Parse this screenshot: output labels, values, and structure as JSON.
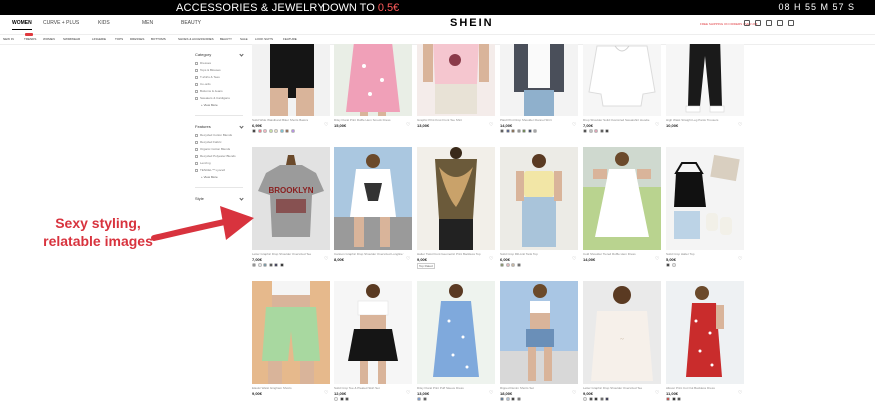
{
  "promo": {
    "accessories": "ACCESSORIES & JEWELRY",
    "down_to": "DOWN TO ",
    "price": "0.5€",
    "timer": "08 H 55 M 57 S"
  },
  "header": {
    "categories": [
      "WOMEN",
      "CURVE + PLUS",
      "KIDS",
      "MEN",
      "BEAUTY"
    ],
    "logo": "SHEIN",
    "topright": "FREE SHIPPING ON ORDERS OVER 29€"
  },
  "subnav": [
    "NEW IN",
    "TRENDS",
    "WOMEN",
    "SWIMWEAR",
    "LINGERIE",
    "TOPS",
    "DRESSES",
    "BOTTOMS",
    "SHOES & ACCESSORIES",
    "BEAUTY",
    "SALE",
    "LOOK SUITS",
    "FEATURE"
  ],
  "sidebar": {
    "category_title": "Category",
    "category_items": [
      "Dresses",
      "Tops & Blouses",
      "T-shirts & Tees",
      "Co-ords",
      "Bottoms & Jeans",
      "Sweaters & Cardigans"
    ],
    "view_more": "+ View More",
    "features_title": "Features",
    "features_items": [
      "Recycled Cotton Blends",
      "Recycled Fabric",
      "Organic Cotton Blends",
      "Recycled Polyester Blends",
      "Lenzing",
      "TENCEL™ Lyocell"
    ],
    "view_more_2": "+ View More",
    "style_title": "Style"
  },
  "products": [
    {
      "name": "Solid Wide Waistband Biker Shorts Basics",
      "price": "6,99€",
      "swatches": [
        "#222222",
        "#ff6b81",
        "#ffb3c1",
        "#c7e99a",
        "#f2e6c9",
        "#6cc3d5",
        "#8a5a3b",
        "#b388eb"
      ]
    },
    {
      "name": "Ditsy Floral Print Ruffle Hem Smock Dress",
      "price": "15,00€",
      "swatches": []
    },
    {
      "name": "Graphic Print Knot Front Tee Shirt",
      "price": "13,00€",
      "swatches": []
    },
    {
      "name": "Plaid Print Drop Shoulder Flannel Shirt",
      "price": "14,00€",
      "swatches": [
        "#444444",
        "#3b4a7a",
        "#7a5c3b",
        "#888888",
        "#5a7a3b",
        "#223355",
        "#a0a0a0"
      ]
    },
    {
      "name": "Drop Shoulder Solid Oversized Sweatshirt Hoodie",
      "price": "7,00€",
      "swatches": [
        "#333333",
        "#c0c0c0",
        "#e8a0b4",
        "#444444",
        "#222222"
      ]
    },
    {
      "name": "High Waist Straight Leg Pants Trousers",
      "price": "10,00€",
      "swatches": []
    },
    {
      "name": "Letter Graphic Drop Shoulder Oversized Tee",
      "price": "7,00€",
      "tag": "",
      "swatches": [
        "#888888",
        "#f0f0f0",
        "#6b8e9e",
        "#3d3d3d",
        "#222244",
        "#111111"
      ]
    },
    {
      "name": "Cartoon Graphic Drop Shoulder Oversized Longline Tee",
      "price": "8,00€",
      "swatches": []
    },
    {
      "name": "Halter Twist Front Geometric Print Backless Top",
      "price": "9,00€",
      "tag": "Top Rated",
      "swatches": []
    },
    {
      "name": "Solid Crop Rib-knit Tank Top",
      "price": "6,00€",
      "swatches": [
        "#7a8a5a",
        "#e8b4b8",
        "#c9b59c",
        "#5a5a5a"
      ]
    },
    {
      "name": "Cold Shoulder Tiered Ruffle Hem Dress",
      "price": "14,00€",
      "swatches": []
    },
    {
      "name": "Solid Crop Halter Top",
      "price": "5,00€",
      "swatches": [
        "#222222",
        "#f0f0f0"
      ]
    },
    {
      "name": "Elastic Waist Gingham Shorts",
      "price": "9,00€",
      "swatches": []
    },
    {
      "name": "Solid Crop Tee & Pleated Skirt Set",
      "price": "12,00€",
      "swatches": [
        "#ffffff",
        "#111111",
        "#333333"
      ]
    },
    {
      "name": "Ditsy Floral Print Puff Sleeve Dress",
      "price": "13,00€",
      "swatches": [
        "#6b8ec7",
        "#444444"
      ]
    },
    {
      "name": "Ripped Denim Shorts Set",
      "price": "18,00€",
      "swatches": [
        "#4a6a8a",
        "#aac0d8",
        "#222222",
        "#666666"
      ]
    },
    {
      "name": "Letter Graphic Drop Shoulder Oversized Tee",
      "price": "9,00€",
      "swatches": [
        "#f3f3f3",
        "#333333",
        "#111111",
        "#555555",
        "#1a1a3a"
      ]
    },
    {
      "name": "Allover Print Cut Out Backless Dress",
      "price": "11,00€",
      "swatches": [
        "#c1322e",
        "#111111",
        "#333333"
      ]
    }
  ],
  "annotation": {
    "line1": "Sexy styling,",
    "line2": "relatable images",
    "color": "#d8333e"
  }
}
